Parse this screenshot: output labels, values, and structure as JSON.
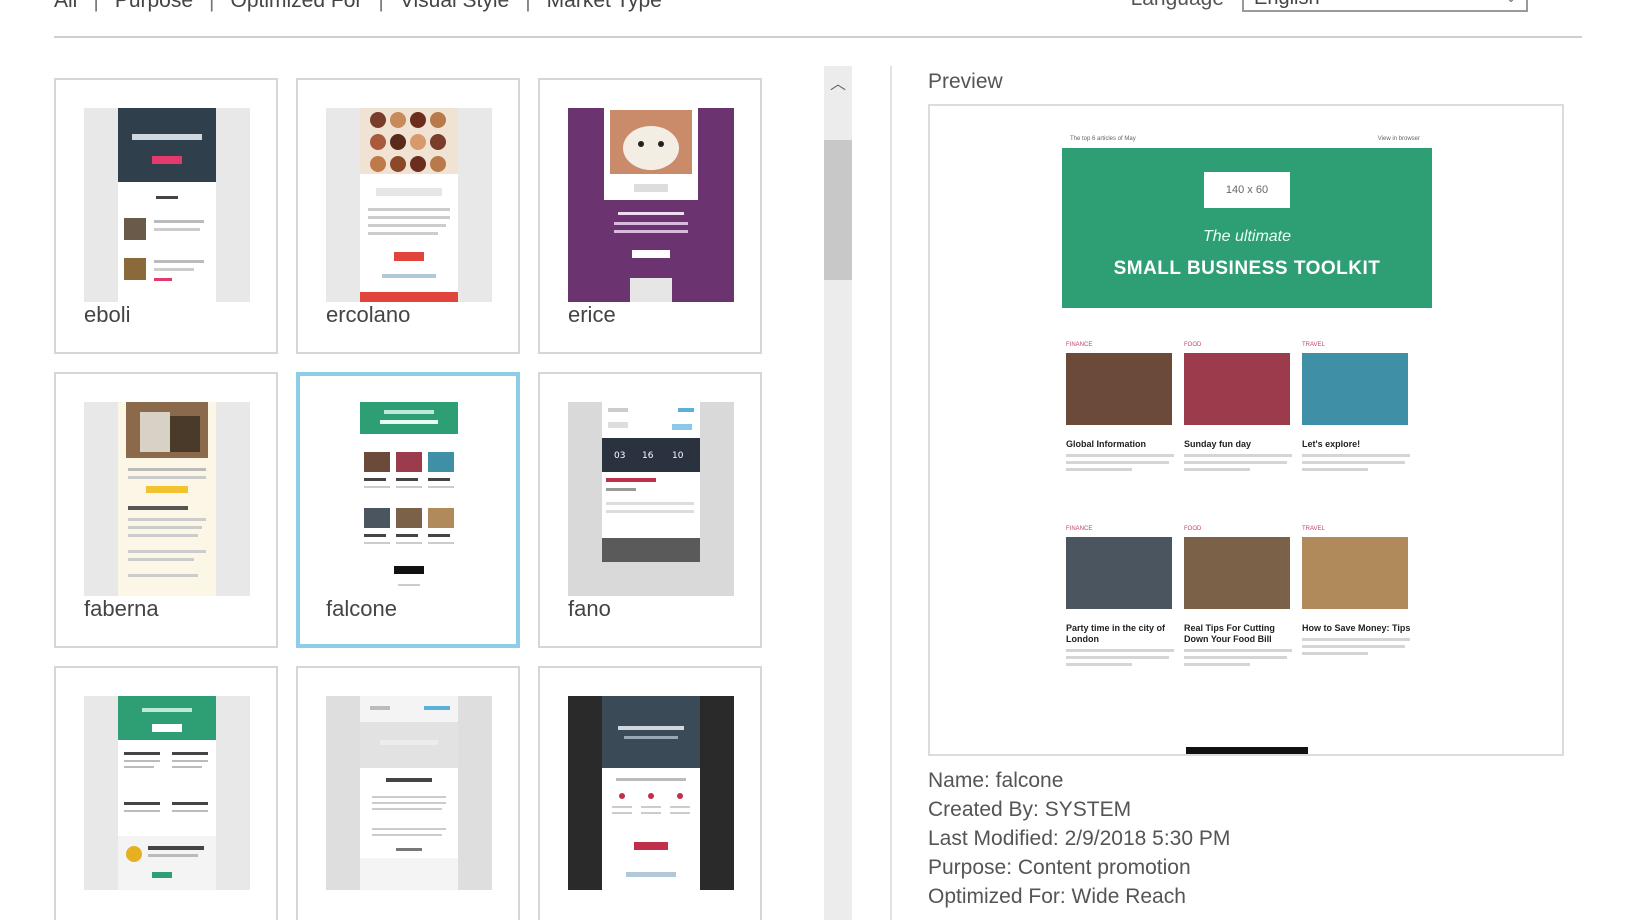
{
  "filters": {
    "items": [
      "All",
      "Purpose",
      "Optimized For",
      "Visual Style",
      "Market Type"
    ]
  },
  "language": {
    "label": "Language",
    "value": "English"
  },
  "templates": [
    {
      "name": "eboli"
    },
    {
      "name": "ercolano"
    },
    {
      "name": "erice"
    },
    {
      "name": "faberna"
    },
    {
      "name": "falcone",
      "selected": true
    },
    {
      "name": "fano"
    },
    {
      "name": ""
    },
    {
      "name": ""
    },
    {
      "name": ""
    }
  ],
  "preview": {
    "heading": "Preview",
    "top_left_text": "The top 6 articles of May",
    "top_right_text": "View in browser",
    "logo_placeholder": "140 x 60",
    "hero_subtitle": "The ultimate",
    "hero_title": "SMALL BUSINESS TOOLKIT",
    "articles": [
      {
        "tag": "FINANCE",
        "title": "Global Information",
        "color": "#6b4a3a"
      },
      {
        "tag": "FOOD",
        "title": "Sunday fun day",
        "color": "#9c3b4c"
      },
      {
        "tag": "TRAVEL",
        "title": "Let's explore!",
        "color": "#3f8fa6"
      },
      {
        "tag": "FINANCE",
        "title": "Party time in the city of London",
        "color": "#4b5560"
      },
      {
        "tag": "FOOD",
        "title": "Real Tips For Cutting Down Your Food Bill",
        "color": "#7a6148"
      },
      {
        "tag": "TRAVEL",
        "title": "How to Save Money: Tips",
        "color": "#b08a5a"
      }
    ]
  },
  "details": {
    "name": "Name: falcone",
    "created_by": "Created By: SYSTEM",
    "last_modified": "Last Modified: 2/9/2018 5:30 PM",
    "purpose": "Purpose: Content promotion",
    "optimized_for": "Optimized For: Wide Reach"
  },
  "colors": {
    "accent_green": "#2e9e75",
    "selection_border": "#8ecde8"
  }
}
